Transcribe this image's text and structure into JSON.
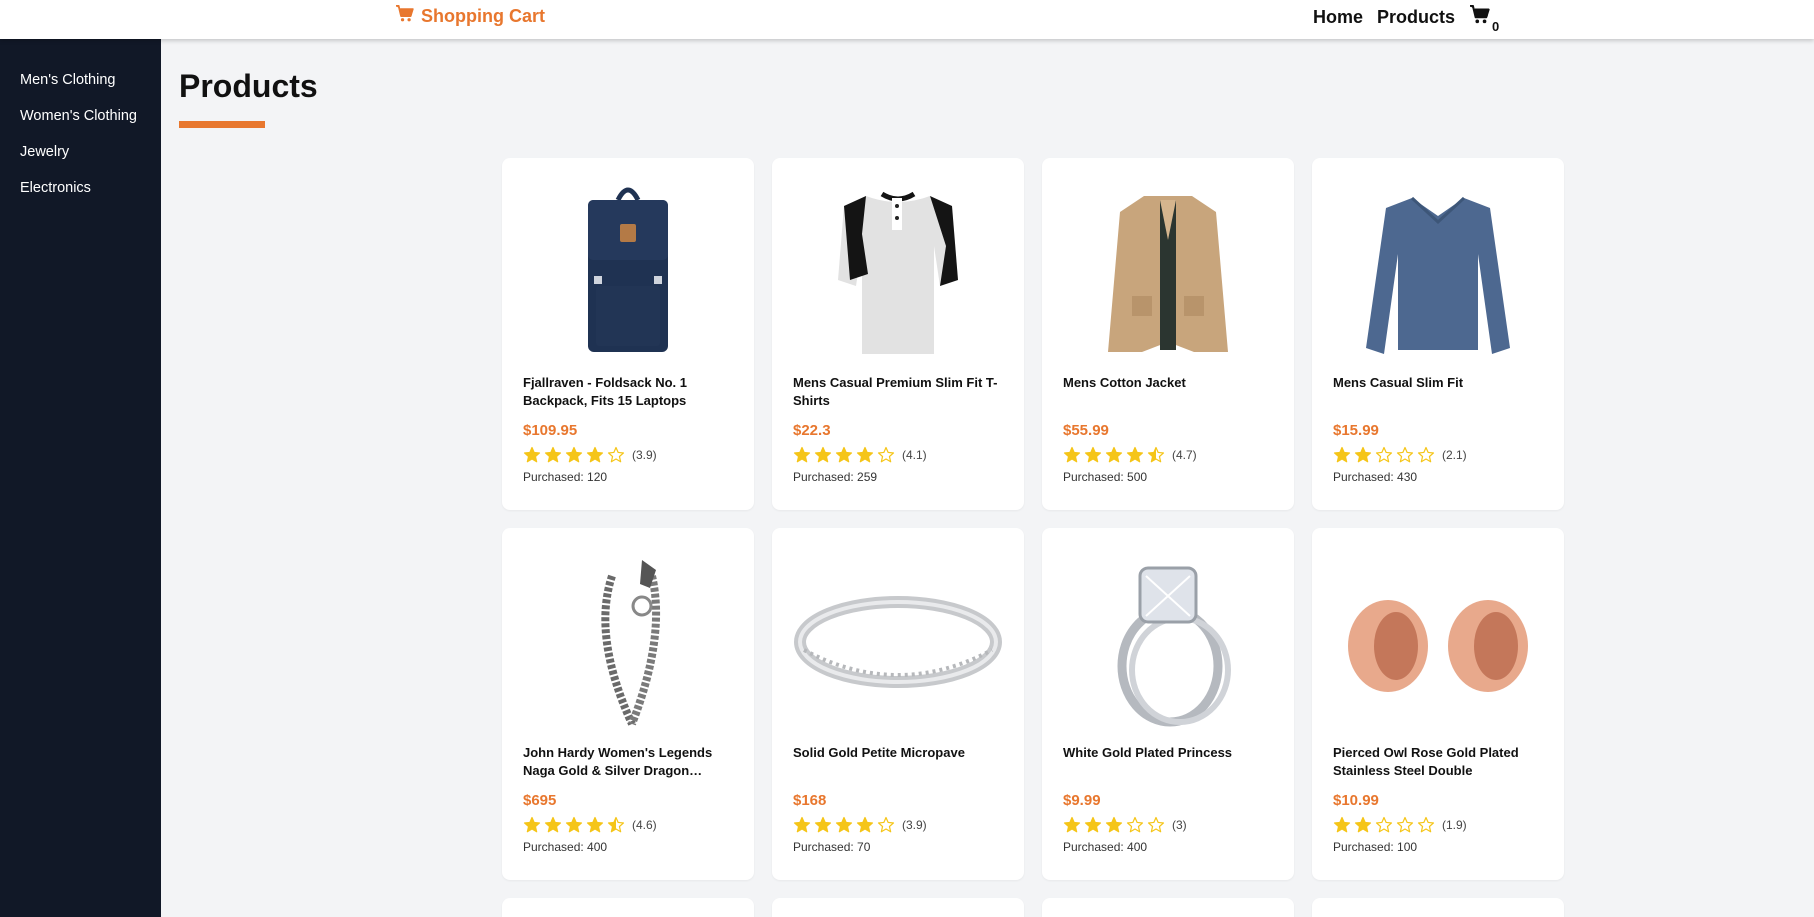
{
  "header": {
    "brand": "Shopping Cart",
    "nav": {
      "home": "Home",
      "products": "Products"
    },
    "cart_count": "0",
    "accent": "#e8772e"
  },
  "sidebar": {
    "items": [
      {
        "label": "Men's Clothing"
      },
      {
        "label": "Women's Clothing"
      },
      {
        "label": "Jewelry"
      },
      {
        "label": "Electronics"
      }
    ]
  },
  "main": {
    "title": "Products",
    "products": [
      {
        "title": "Fjallraven - Foldsack No. 1 Backpack, Fits 15 Laptops",
        "price": "$109.95",
        "rating": 3.9,
        "rating_label": "(3.9)",
        "purchased": "Purchased: 120",
        "image": "backpack"
      },
      {
        "title": "Mens Casual Premium Slim Fit T-Shirts",
        "price": "$22.3",
        "rating": 4.1,
        "rating_label": "(4.1)",
        "purchased": "Purchased: 259",
        "image": "raglan-tshirt"
      },
      {
        "title": "Mens Cotton Jacket",
        "price": "$55.99",
        "rating": 4.7,
        "rating_label": "(4.7)",
        "purchased": "Purchased: 500",
        "image": "jacket"
      },
      {
        "title": "Mens Casual Slim Fit",
        "price": "$15.99",
        "rating": 2.1,
        "rating_label": "(2.1)",
        "purchased": "Purchased: 430",
        "image": "longsleeve-shirt"
      },
      {
        "title": "John Hardy Women's Legends Naga Gold & Silver Dragon Station Chain Bracelet",
        "price": "$695",
        "rating": 4.6,
        "rating_label": "(4.6)",
        "purchased": "Purchased: 400",
        "image": "dragon-bracelet"
      },
      {
        "title": "Solid Gold Petite Micropave",
        "price": "$168",
        "rating": 3.9,
        "rating_label": "(3.9)",
        "purchased": "Purchased: 70",
        "image": "silver-ring"
      },
      {
        "title": "White Gold Plated Princess",
        "price": "$9.99",
        "rating": 3,
        "rating_label": "(3)",
        "purchased": "Purchased: 400",
        "image": "diamond-ring"
      },
      {
        "title": "Pierced Owl Rose Gold Plated Stainless Steel Double",
        "price": "$10.99",
        "rating": 1.9,
        "rating_label": "(1.9)",
        "purchased": "Purchased: 100",
        "image": "rose-gold-plugs"
      }
    ],
    "star_color": "#f5c518"
  }
}
